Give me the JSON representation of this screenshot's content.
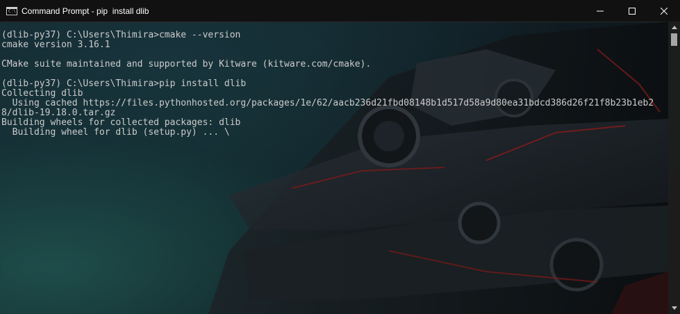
{
  "window": {
    "title": "Command Prompt - pip  install dlib",
    "app_icon_text": "C:\\"
  },
  "console": {
    "lines": [
      "(dlib-py37) C:\\Users\\Thimira>cmake --version",
      "cmake version 3.16.1",
      "",
      "CMake suite maintained and supported by Kitware (kitware.com/cmake).",
      "",
      "(dlib-py37) C:\\Users\\Thimira>pip install dlib",
      "Collecting dlib",
      "  Using cached https://files.pythonhosted.org/packages/1e/62/aacb236d21fbd08148b1d517d58a9d80ea31bdcd386d26f21f8b23b1eb2",
      "8/dlib-19.18.0.tar.gz",
      "Building wheels for collected packages: dlib",
      "  Building wheel for dlib (setup.py) ... \\"
    ]
  },
  "icons": {
    "minimize": "minimize-icon",
    "maximize": "maximize-icon",
    "close": "close-icon"
  }
}
